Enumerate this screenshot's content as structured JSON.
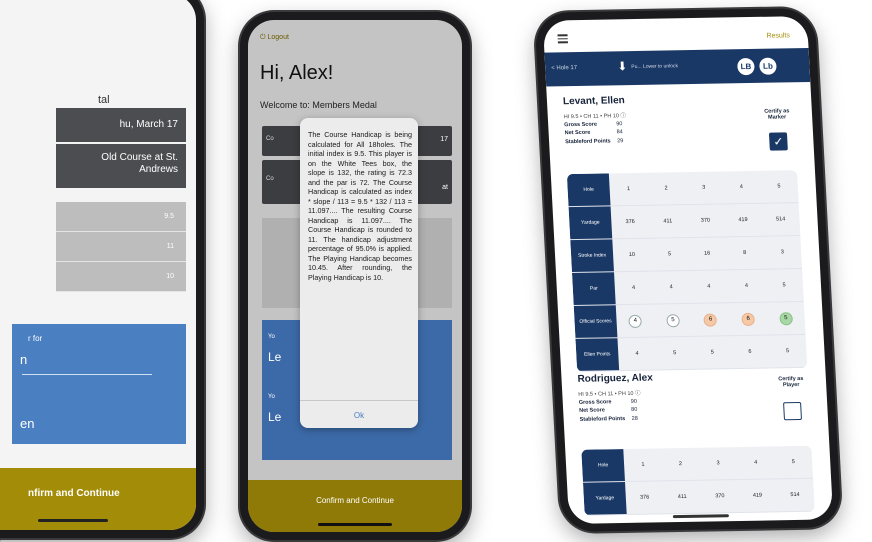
{
  "colors": {
    "accent_gold": "#a38c07",
    "navy": "#193866",
    "blue": "#4a7fc2",
    "diagonal_blue": "#1a8fd8"
  },
  "phone1": {
    "label_partial": "tal",
    "date": "hu, March 17",
    "course": "Old Course at St. Andrews",
    "rows": [
      "9.5",
      "11",
      "10"
    ],
    "blue_label": "r for",
    "blue_value1": "n",
    "blue_value2": "en",
    "confirm": "nfirm and Continue"
  },
  "phone2": {
    "logout": "Logout",
    "greeting": "Hi, Alex!",
    "welcome": "Welcome to: Members Medal",
    "side_fragments": [
      "17",
      "at",
      "Co",
      "Co",
      "Yo",
      "Le",
      "Yo",
      "Le"
    ],
    "dialog_text": "The Course Handicap is being calculated for All 18holes. The initial index is 9.5. This player is on the White Tees box, the slope is 132, the rating is 72.3 and the par is 72. The Course Handicap is calculated as index * slope / 113 = 9.5 * 132 / 113 = 11.097.... The resulting Course Handicap is 11.097.... The Course Handicap is rounded to 11. The handicap adjustment percentage of 95.0% is applied. The Playing Handicap becomes 10.45. After rounding, the Playing Handicap is 10.",
    "dialog_ok": "Ok",
    "confirm": "Confirm and Continue"
  },
  "phone3": {
    "results_link": "Results",
    "hole_label": "< Hole 17",
    "nav_text": "Pu... Lower to unlock",
    "circle1": "LB",
    "circle2": "Lb",
    "player1": {
      "name": "Levant, Ellen",
      "sub": "HI 9.5  •  CH 11  •  PH 10",
      "gross_label": "Gross Score",
      "gross": "90",
      "net_label": "Net Score",
      "net": "84",
      "stable_label": "Stableford Points",
      "stable": "29",
      "certify": "Certify as Marker",
      "scorecard": {
        "rows": [
          {
            "head": "Hole",
            "cells": [
              "1",
              "2",
              "3",
              "4",
              "5"
            ]
          },
          {
            "head": "Yardage",
            "cells": [
              "376",
              "411",
              "370",
              "419",
              "514"
            ]
          },
          {
            "head": "Stroke Index",
            "cells": [
              "10",
              "5",
              "16",
              "8",
              "3"
            ]
          },
          {
            "head": "Par",
            "cells": [
              "4",
              "4",
              "4",
              "4",
              "5"
            ]
          },
          {
            "head": "Official Scores",
            "cells": [
              "4",
              "5",
              "6",
              "6",
              "5"
            ],
            "circles": [
              "",
              "",
              "o",
              "o",
              "g"
            ]
          },
          {
            "head": "Ellen Points",
            "cells": [
              "4",
              "5",
              "5",
              "6",
              "5"
            ]
          }
        ]
      }
    },
    "player2": {
      "name": "Rodriguez, Alex",
      "sub": "HI 9.5  •  CH 11  •  PH 10",
      "gross_label": "Gross Score",
      "gross": "90",
      "net_label": "Net Score",
      "net": "80",
      "stable_label": "Stableford Points",
      "stable": "28",
      "certify": "Certify as Player",
      "scorecard": {
        "rows": [
          {
            "head": "Hole",
            "cells": [
              "1",
              "2",
              "3",
              "4",
              "5"
            ]
          },
          {
            "head": "Yardage",
            "cells": [
              "376",
              "411",
              "370",
              "419",
              "514"
            ]
          }
        ]
      }
    }
  }
}
